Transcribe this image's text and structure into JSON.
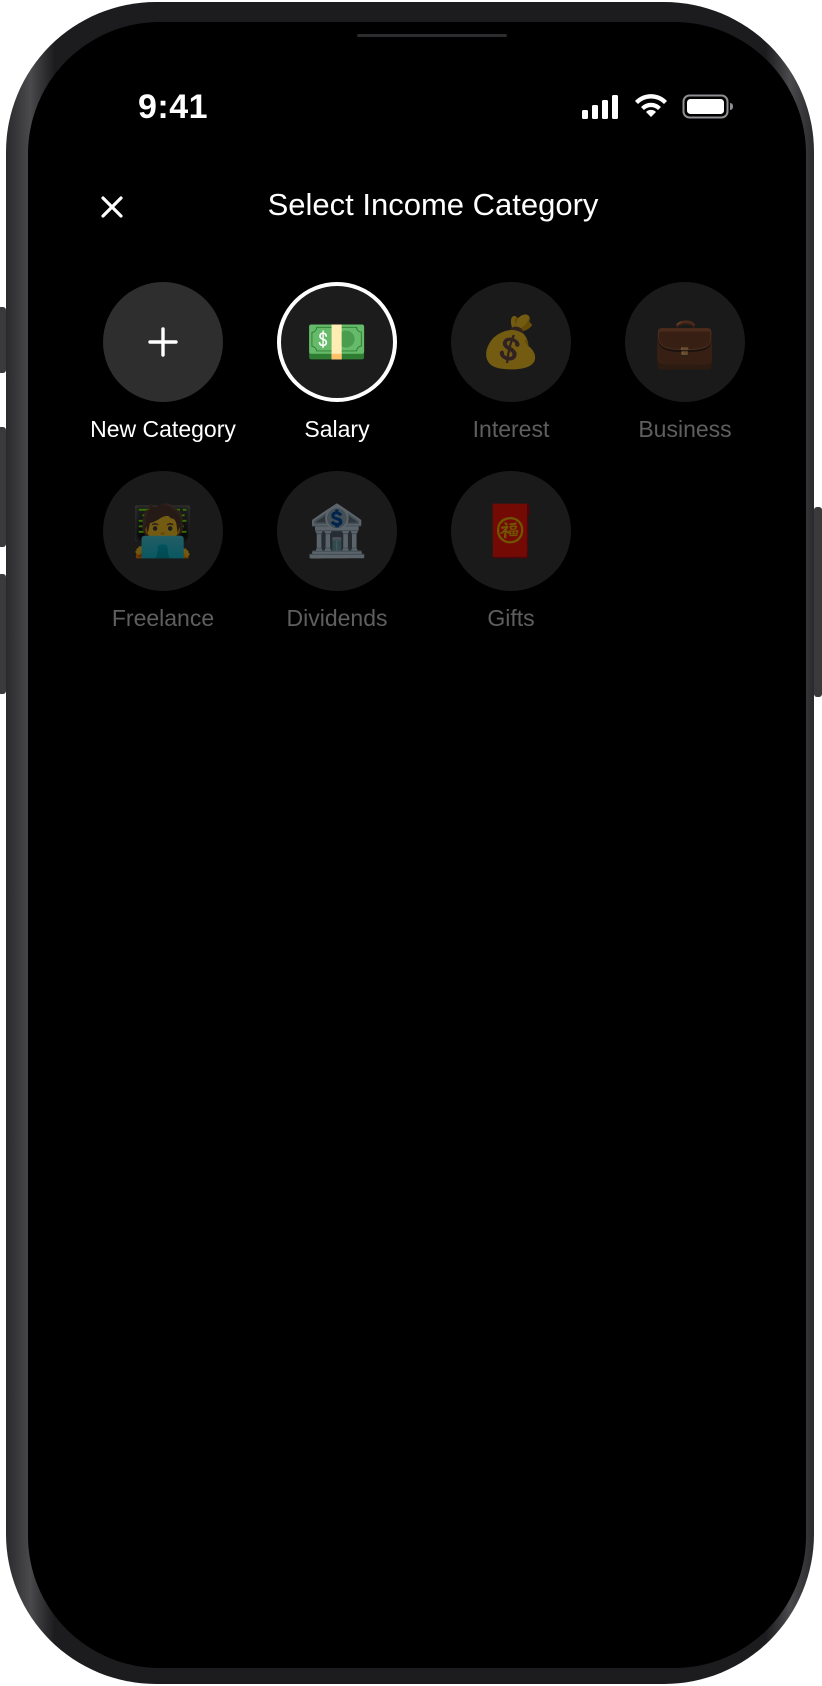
{
  "status_bar": {
    "time": "9:41"
  },
  "header": {
    "title": "Select Income Category",
    "close_icon": "close-icon"
  },
  "categories": [
    {
      "label": "New Category",
      "icon": "plus-icon",
      "glyph": "+",
      "state": "add"
    },
    {
      "label": "Salary",
      "icon": "money-icon",
      "glyph": "💵",
      "state": "selected"
    },
    {
      "label": "Interest",
      "icon": "money-bag-icon",
      "glyph": "💰",
      "state": "dim"
    },
    {
      "label": "Business",
      "icon": "briefcase-icon",
      "glyph": "💼",
      "state": "dim"
    },
    {
      "label": "Freelance",
      "icon": "technologist-icon",
      "glyph": "🧑‍💻",
      "state": "dim"
    },
    {
      "label": "Dividends",
      "icon": "bank-icon",
      "glyph": "🏦",
      "state": "dim"
    },
    {
      "label": "Gifts",
      "icon": "red-envelope-icon",
      "glyph": "🧧",
      "state": "dim"
    }
  ],
  "colors": {
    "background": "#000000",
    "text_primary": "#ffffff",
    "text_dim": "#5f5f5f",
    "circle_fill": "#1a1a1a",
    "selected_border": "#ffffff"
  }
}
